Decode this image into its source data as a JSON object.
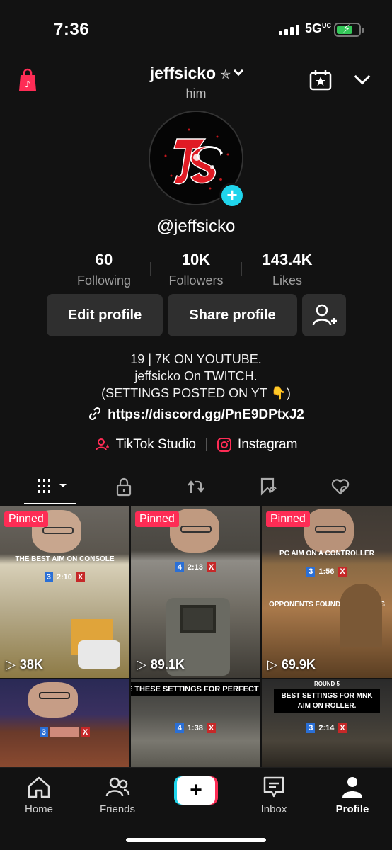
{
  "status_bar": {
    "time": "7:36",
    "network": "5G",
    "network_suffix": "UC"
  },
  "header": {
    "username": "jeffsicko",
    "pronouns": "him"
  },
  "profile": {
    "handle": "@jeffsicko",
    "stats": [
      {
        "value": "60",
        "label": "Following"
      },
      {
        "value": "10K",
        "label": "Followers"
      },
      {
        "value": "143.4K",
        "label": "Likes"
      }
    ],
    "edit_label": "Edit profile",
    "share_label": "Share profile",
    "bio_lines": [
      "19 | 7K ON YOUTUBE.",
      "jeffsicko On TWITCH.",
      "(SETTINGS POSTED ON YT 👇)"
    ],
    "link": "https://discord.gg/PnE9DPtxJ2",
    "apps": {
      "studio": "TikTok Studio",
      "instagram": "Instagram"
    }
  },
  "tabs": [
    "videos-grid",
    "private",
    "reposts",
    "favorites",
    "liked"
  ],
  "videos": [
    {
      "pinned": "Pinned",
      "views": "38K",
      "caption": "THE BEST AIM ON CONSOLE"
    },
    {
      "pinned": "Pinned",
      "views": "89.1K",
      "caption": ""
    },
    {
      "pinned": "Pinned",
      "views": "69.9K",
      "caption": "PC AIM ON A CONTROLLER",
      "overlay": "OPPONENTS FOUND THE BOMBS"
    },
    {
      "caption": ""
    },
    {
      "caption": "USE THESE SETTINGS FOR PERFECT AIM"
    },
    {
      "caption": "BEST SETTINGS FOR MNK AIM ON ROLLER."
    }
  ],
  "hud": {
    "t1": "2:10",
    "t2": "2:13",
    "t3": "1:56",
    "t4": "1:38",
    "t5": "2:14",
    "s1": "3",
    "s2": "4",
    "s3": "3",
    "s4": "4",
    "s5": "3",
    "round_label": "ROUND 5"
  },
  "bottom_nav": [
    {
      "label": "Home"
    },
    {
      "label": "Friends"
    },
    {
      "label": "Inbox"
    },
    {
      "label": "Profile"
    }
  ],
  "colors": {
    "accent_red": "#fe2c55",
    "accent_cyan": "#20d5ec",
    "background": "#121212"
  }
}
